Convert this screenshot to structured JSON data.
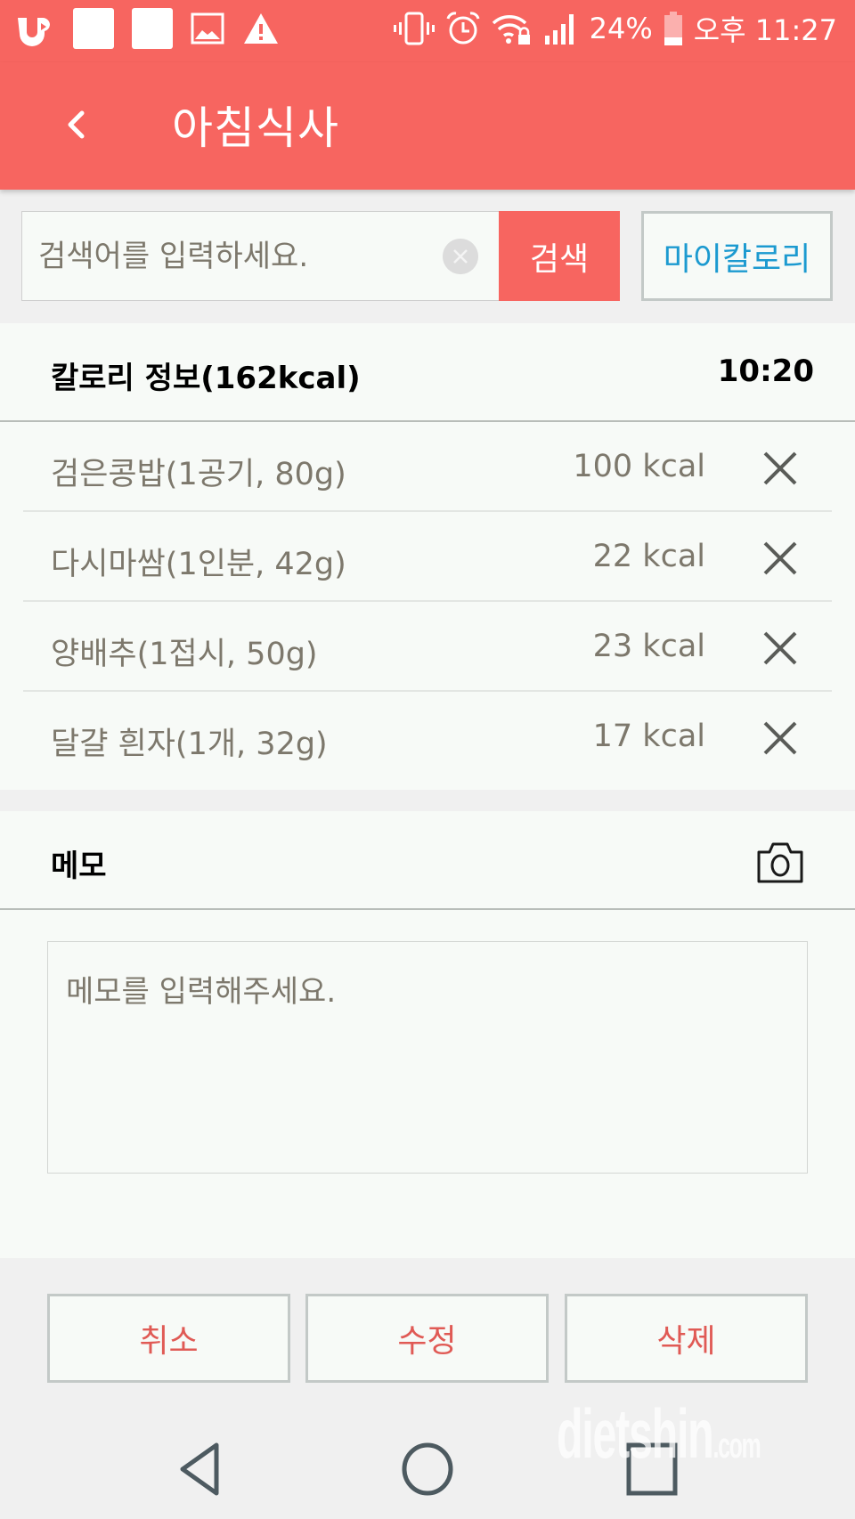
{
  "status_bar": {
    "left_icons": [
      "uplus-icon",
      "notification-square-icon",
      "notification-square-icon",
      "image-icon",
      "warning-icon"
    ],
    "right_icons": [
      "vibrate-icon",
      "alarm-icon",
      "wifi-lock-icon",
      "signal-icon"
    ],
    "battery_percent": "24%",
    "time": "오후 11:27"
  },
  "header": {
    "title": "아침식사",
    "back_icon": "chevron-left-icon"
  },
  "search": {
    "placeholder": "검색어를 입력하세요.",
    "value": "",
    "search_label": "검색",
    "my_calorie_label": "마이칼로리"
  },
  "calorie_info": {
    "title": "칼로리 정보(162kcal)",
    "time": "10:20",
    "items": [
      {
        "name": "검은콩밥(1공기, 80g)",
        "kcal": "100 kcal"
      },
      {
        "name": "다시마쌈(1인분, 42g)",
        "kcal": "22 kcal"
      },
      {
        "name": "양배추(1접시, 50g)",
        "kcal": "23 kcal"
      },
      {
        "name": "달걀 흰자(1개, 32g)",
        "kcal": "17 kcal"
      }
    ]
  },
  "memo": {
    "title": "메모",
    "placeholder": "메모를 입력해주세요.",
    "value": ""
  },
  "actions": {
    "cancel": "취소",
    "edit": "수정",
    "delete": "삭제"
  },
  "watermark": {
    "text": "dietshin",
    "suffix": ".com"
  },
  "colors": {
    "brand": "#f76560",
    "link": "#1c9ad0",
    "action_text": "#e05a55"
  }
}
